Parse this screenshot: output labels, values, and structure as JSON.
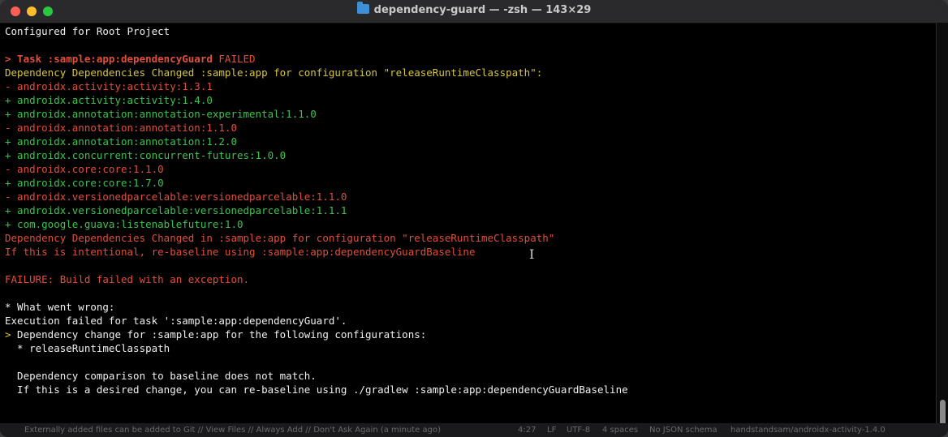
{
  "window": {
    "title": "dependency-guard — -zsh — 143×29"
  },
  "terminal": {
    "lines": [
      {
        "text": "Configured for Root Project",
        "color": "white"
      },
      {
        "text": "",
        "color": "white"
      },
      {
        "prefix": "> Task :sample:app:dependencyGuard",
        "text": " FAILED",
        "color": "red"
      },
      {
        "text": "Dependency Dependencies Changed :sample:app for configuration \"releaseRuntimeClasspath\":",
        "color": "yellow"
      },
      {
        "text": "- androidx.activity:activity:1.3.1",
        "color": "red"
      },
      {
        "text": "+ androidx.activity:activity:1.4.0",
        "color": "green"
      },
      {
        "text": "+ androidx.annotation:annotation-experimental:1.1.0",
        "color": "green"
      },
      {
        "text": "- androidx.annotation:annotation:1.1.0",
        "color": "red"
      },
      {
        "text": "+ androidx.annotation:annotation:1.2.0",
        "color": "green"
      },
      {
        "text": "+ androidx.concurrent:concurrent-futures:1.0.0",
        "color": "green"
      },
      {
        "text": "- androidx.core:core:1.1.0",
        "color": "red"
      },
      {
        "text": "+ androidx.core:core:1.7.0",
        "color": "green"
      },
      {
        "text": "- androidx.versionedparcelable:versionedparcelable:1.1.0",
        "color": "red"
      },
      {
        "text": "+ androidx.versionedparcelable:versionedparcelable:1.1.1",
        "color": "green"
      },
      {
        "text": "+ com.google.guava:listenablefuture:1.0",
        "color": "green"
      },
      {
        "text": "Dependency Dependencies Changed in :sample:app for configuration \"releaseRuntimeClasspath\"",
        "color": "red"
      },
      {
        "text": "If this is intentional, re-baseline using :sample:app:dependencyGuardBaseline",
        "color": "red"
      },
      {
        "text": "",
        "color": "white"
      },
      {
        "text": "FAILURE: Build failed with an exception.",
        "color": "red"
      },
      {
        "text": "",
        "color": "white"
      },
      {
        "text": "* What went wrong:",
        "color": "white"
      },
      {
        "text": "Execution failed for task ':sample:app:dependencyGuard'.",
        "color": "white"
      },
      {
        "prefix": ">",
        "text": " Dependency change for :sample:app for the following configurations:",
        "color": "white",
        "prefix_color": "yellow"
      },
      {
        "text": "  * releaseRuntimeClasspath",
        "color": "white"
      },
      {
        "text": "",
        "color": "white"
      },
      {
        "text": "  Dependency comparison to baseline does not match.",
        "color": "white"
      },
      {
        "text": "  If this is a desired change, you can re-baseline using ./gradlew :sample:app:dependencyGuardBaseline",
        "color": "white"
      }
    ]
  },
  "statusbar": {
    "left": "Externally added files can be added to Git // View Files // Always Add // Don't Ask Again (a minute ago)",
    "position": "4:27",
    "line_sep": "LF",
    "encoding": "UTF-8",
    "indent": "4 spaces",
    "schema": "No JSON schema",
    "branch": "handstandsam/androidx-activity-1.4.0"
  },
  "colors": {
    "white": "#f0f0f0",
    "red": "#e0503c",
    "green": "#3fc24e",
    "yellow": "#d6c641"
  }
}
